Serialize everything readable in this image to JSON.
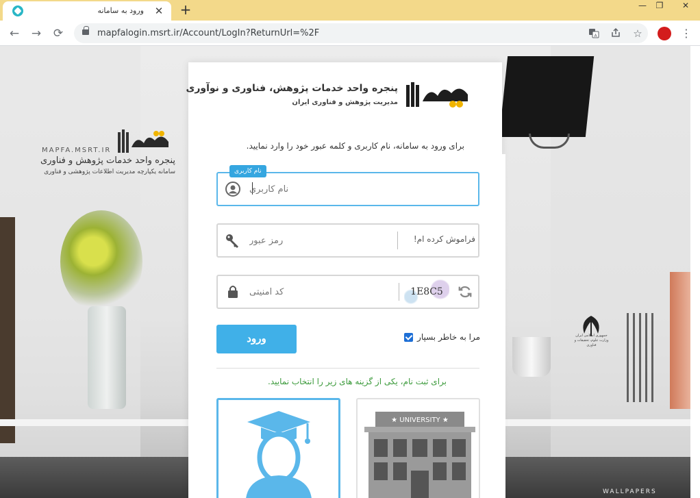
{
  "browser": {
    "tab_title": "ورود به سامانه",
    "new_tab": "+",
    "url": "mapfalogin.msrt.ir/Account/LogIn?ReturnUrl=%2F",
    "controls": {
      "minimize": "—",
      "maximize": "❐",
      "close": "✕",
      "back": "←",
      "forward": "→",
      "reload": "⟳",
      "menu": "⋮",
      "tab_close": "✕"
    }
  },
  "background": {
    "site": "MAPFA.MSRT.IR",
    "title": "پنجره واحد خدمات پژوهش و فناوری",
    "subtitle": "سامانه یکپارچه مدیریت اطلاعات پژوهشی و فناوری",
    "emblem_text": "جمهوری اسلامی ایران وزارت علوم، تحقیقات و فناوری",
    "watermark": "WALLPAPERS"
  },
  "card": {
    "brand_title": "پنجره واحد خدمات پژوهش، فناوری و نوآوری",
    "brand_subtitle": "مدیریت پژوهش و فناوری ایران",
    "intro": "برای ورود به سامانه، نام کاربری و کلمه عبور خود را وارد نمایید.",
    "username": {
      "tag": "نام کاربری",
      "placeholder": "نام کاربری",
      "value": ""
    },
    "password": {
      "placeholder": "رمز عبور",
      "forgot": "فراموش کرده ام!"
    },
    "captcha": {
      "placeholder": "کد امنیتی",
      "code": "1E8C5"
    },
    "login_label": "ورود",
    "remember_label": "مرا به خاطر بسپار",
    "remember_checked": true,
    "register_text": "برای ثبت نام، یکی از گزینه های زیر را انتخاب نمایید.",
    "university_sign": "★ UNIVERSITY ★"
  },
  "colors": {
    "accent": "#40b0e8",
    "focus": "#5ab7ea",
    "register": "#3b9a3b",
    "tabbar": "#f3d98a"
  }
}
